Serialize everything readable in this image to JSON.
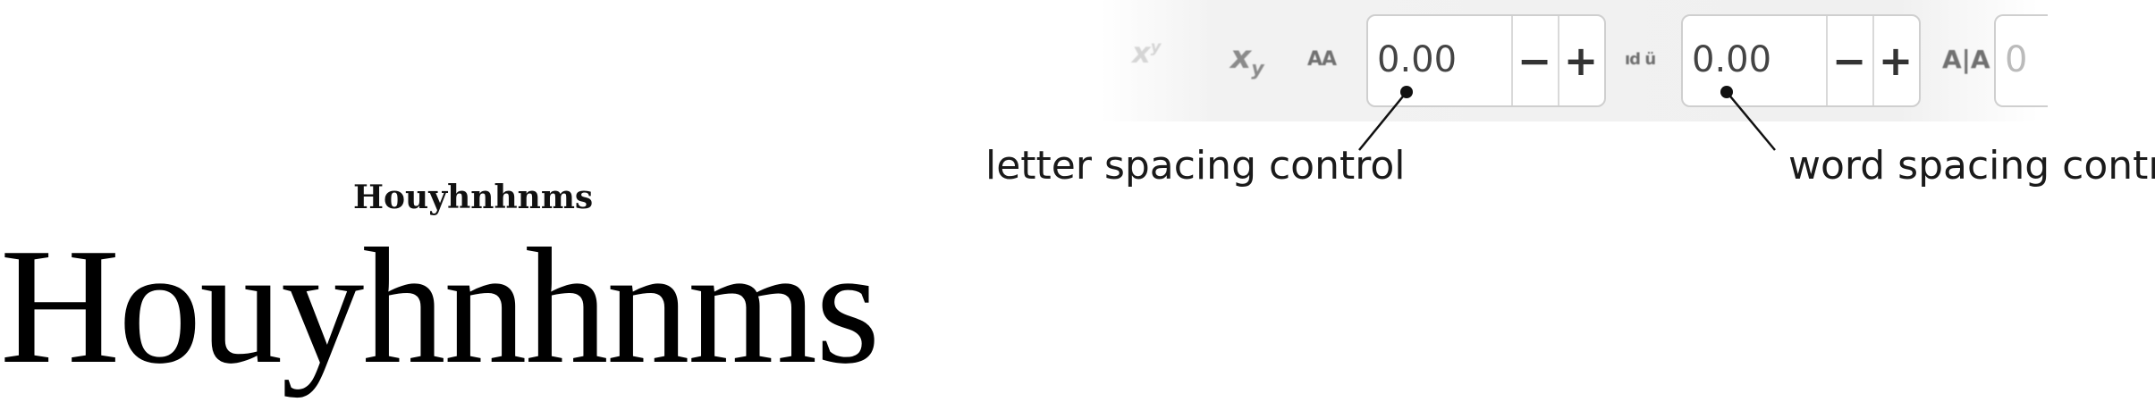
{
  "toolbar": {
    "superscript_icon": "superscript-icon",
    "subscript_icon": "subscript-icon",
    "letter_spacing_icon": "letter-spacing-icon",
    "word_spacing_icon": "word-spacing-icon",
    "kerning_icon": "kerning-icon",
    "letter_spacing": {
      "value": "0.00",
      "minus": "−",
      "plus": "+"
    },
    "word_spacing": {
      "value": "0.00",
      "minus": "−",
      "plus": "+"
    },
    "partial_field_value": "0"
  },
  "callouts": {
    "letter_spacing": "letter spacing control",
    "word_spacing": "word spacing control"
  },
  "specimen": {
    "small": "Houyhnhnms",
    "large": "Houyhnhnms"
  }
}
